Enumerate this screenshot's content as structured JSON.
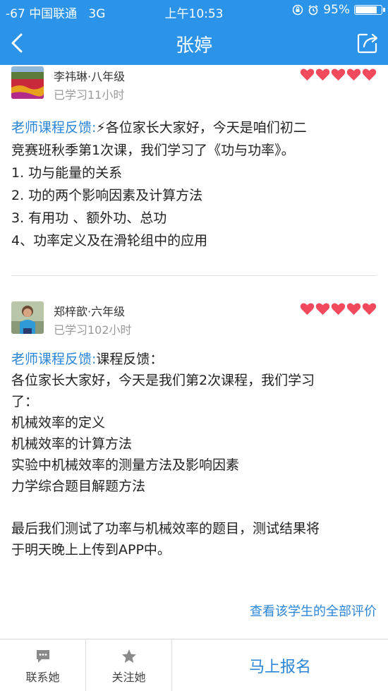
{
  "status_bar": {
    "signal": "-67",
    "carrier": "中国联通",
    "network": "3G",
    "time": "上午10:53",
    "battery_pct": "95%",
    "battery_level": 0.95
  },
  "nav": {
    "title": "张婷",
    "back_icon": "chevron-left-icon",
    "share_icon": "share-icon"
  },
  "reviews": [
    {
      "student": "李祎琳·八年级",
      "study_time": "已学习11小时",
      "rating": 5,
      "feedback_label": "老师课程反馈:",
      "lines": [
        "⚡各位家长大家好，今天是咱们初二",
        "竞赛班秋季第1次课，我们学习了《功与功率》。",
        "1. 功与能量的关系",
        "2. 功的两个影响因素及计算方法",
        "3. 有用功 、额外功、总功",
        "4、功率定义及在滑轮组中的应用"
      ]
    },
    {
      "student": "郑梓歆·六年级",
      "study_time": "已学习102小时",
      "rating": 5,
      "feedback_label": "老师课程反馈:",
      "lines": [
        "课程反馈：",
        "各位家长大家好，今天是我们第2次课程，我们学习",
        "了：",
        "机械效率的定义",
        "机械效率的计算方法",
        "实验中机械效率的测量方法及影响因素",
        "力学综合题目解题方法",
        "",
        "最后我们测试了功率与机械效率的题目，测试结果将",
        "于明天晚上上传到APP中。"
      ]
    }
  ],
  "all_reviews_link": "查看该学生的全部评价",
  "tabbar": {
    "contact": "联系她",
    "follow": "关注她",
    "enroll": "马上报名"
  },
  "colors": {
    "primary": "#2b93e8",
    "link": "#2b85d6",
    "heart": "#f04a5c"
  }
}
